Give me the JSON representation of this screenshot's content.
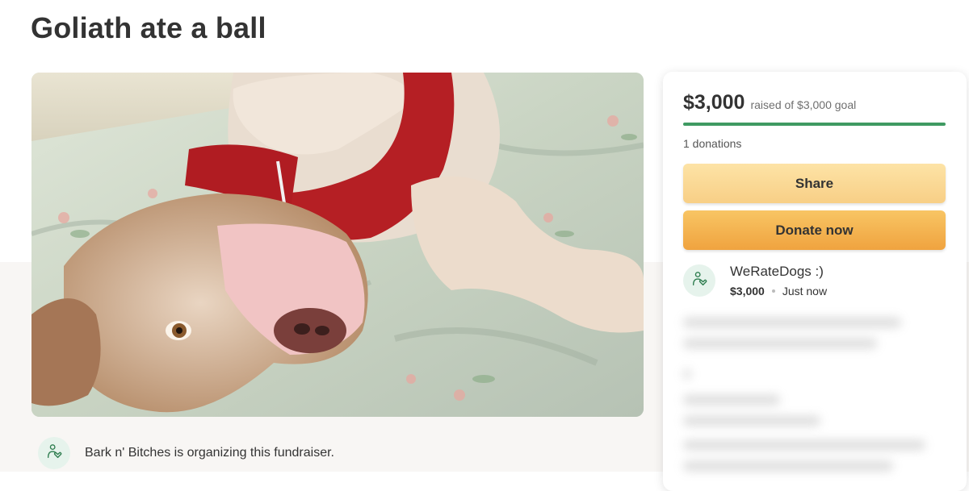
{
  "page": {
    "title": "Goliath ate a ball"
  },
  "hero_image": {
    "alt": "Dog with red harness lying upside down on a floral bedsheet"
  },
  "organizer": {
    "text": "Bark n' Bitches is organizing this fundraiser.",
    "icon": "hand-heart-icon"
  },
  "donation_card": {
    "amount_raised": "$3,000",
    "goal_text": "raised of $3,000 goal",
    "progress_fraction": 1.0,
    "donations_count": "1 donations",
    "share_label": "Share",
    "donate_label": "Donate now",
    "recent_donation": {
      "name": "WeRateDogs :)",
      "amount": "$3,000",
      "time": "Just now",
      "icon": "hand-heart-icon"
    }
  },
  "colors": {
    "progress_green": "#3f9a62",
    "share_button": "#fad598",
    "donate_button": "#f4b04e",
    "avatar_bg": "#e6f3ec",
    "icon_green": "#2e7d4f"
  }
}
